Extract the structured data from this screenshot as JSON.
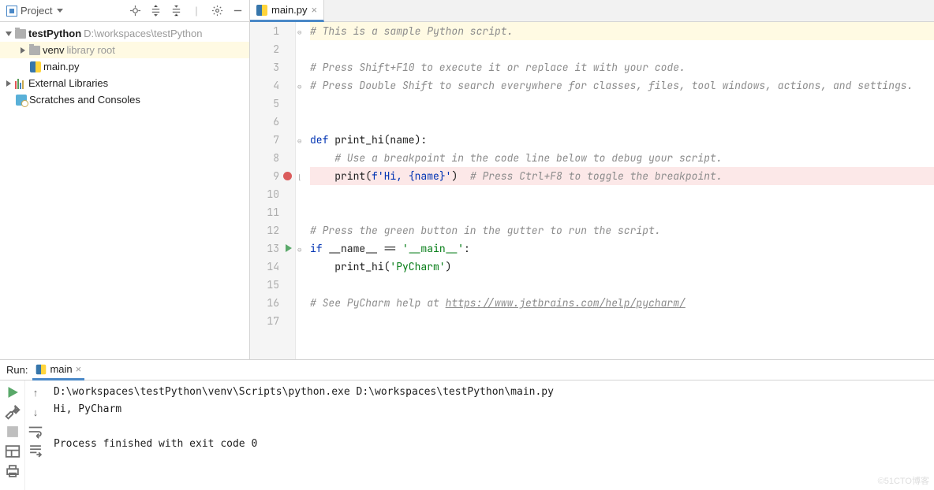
{
  "sidebar": {
    "title": "Project",
    "root": {
      "name": "testPython",
      "path": "D:\\workspaces\\testPython"
    },
    "venv": {
      "name": "venv",
      "hint": "library root"
    },
    "file": "main.py",
    "ext": "External Libraries",
    "scratch": "Scratches and Consoles"
  },
  "tab": {
    "name": "main.py"
  },
  "code": {
    "l1": "# This is a sample Python script.",
    "l3": "# Press Shift+F10 to execute it or replace it with your code.",
    "l4": "# Press Double Shift to search everywhere for classes, files, tool windows, actions, and settings.",
    "l7def": "def ",
    "l7fn": "print_hi",
    "l7rest": "(name):",
    "l8": "    # Use a breakpoint in the code line below to debug your script.",
    "l9a": "    print(",
    "l9b": "f'Hi, ",
    "l9c": "{name}",
    "l9d": "'",
    "l9e": ")  ",
    "l9f": "# Press Ctrl+F8 to toggle the breakpoint.",
    "l12": "# Press the green button in the gutter to run the script.",
    "l13a": "if ",
    "l13b": "__name__ == ",
    "l13c": "'__main__'",
    "l13d": ":",
    "l14a": "    print_hi(",
    "l14b": "'PyCharm'",
    "l14c": ")",
    "l16a": "# See PyCharm help at ",
    "l16b": "https://www.jetbrains.com/help/pycharm/"
  },
  "lines": {
    "1": "1",
    "2": "2",
    "3": "3",
    "4": "4",
    "5": "5",
    "6": "6",
    "7": "7",
    "8": "8",
    "9": "9",
    "10": "10",
    "11": "11",
    "12": "12",
    "13": "13",
    "14": "14",
    "15": "15",
    "16": "16",
    "17": "17"
  },
  "run": {
    "label": "Run:",
    "tab": "main",
    "cmd": "D:\\workspaces\\testPython\\venv\\Scripts\\python.exe D:\\workspaces\\testPython\\main.py",
    "out": "Hi, PyCharm",
    "exit": "Process finished with exit code 0"
  },
  "watermark": "©51CTO博客"
}
